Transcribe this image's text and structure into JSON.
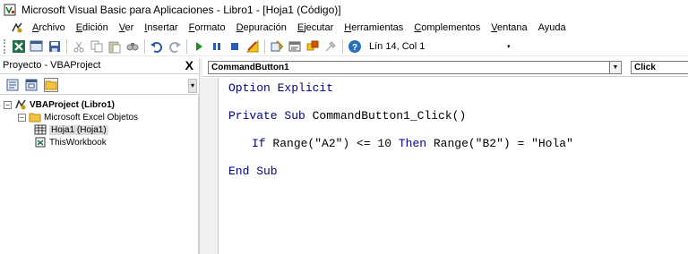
{
  "window": {
    "title": "Microsoft Visual Basic para Aplicaciones - Libro1 - [Hoja1 (Código)]"
  },
  "menu": {
    "items": [
      {
        "ul": "A",
        "rest": "rchivo"
      },
      {
        "ul": "E",
        "rest": "dición"
      },
      {
        "ul": "V",
        "rest": "er"
      },
      {
        "ul": "I",
        "rest": "nsertar"
      },
      {
        "ul": "F",
        "rest": "ormato"
      },
      {
        "ul": "D",
        "rest": "epuración"
      },
      {
        "ul": "E",
        "rest": "jecutar"
      },
      {
        "ul": "H",
        "rest": "erramientas"
      },
      {
        "ul": "C",
        "rest": "omplementos"
      },
      {
        "ul": "V",
        "rest": "entana"
      },
      {
        "ul": "",
        "rest": "Ayuda"
      }
    ]
  },
  "toolbar": {
    "position": "Lín 14, Col 1"
  },
  "project": {
    "title": "Proyecto - VBAProject",
    "close": "X",
    "tree": {
      "root": "VBAProject (Libro1)",
      "folder": "Microsoft Excel Objetos",
      "sheet": "Hoja1 (Hoja1)",
      "workbook": "ThisWorkbook"
    }
  },
  "code_window": {
    "object_combo": "CommandButton1",
    "proc_combo": "Click",
    "lines": {
      "l1_kw": "Option Explicit",
      "l2_kw": "Private Sub",
      "l2_rest": " CommandButton1_Click()",
      "l3_kw1": "If",
      "l3_mid": " Range(\"A2\") <= 10 ",
      "l3_kw2": "Then",
      "l3_end": " Range(\"B2\") = \"Hola\"",
      "l4_kw": "End Sub"
    }
  },
  "colors": {
    "keyword": "#00008b"
  }
}
